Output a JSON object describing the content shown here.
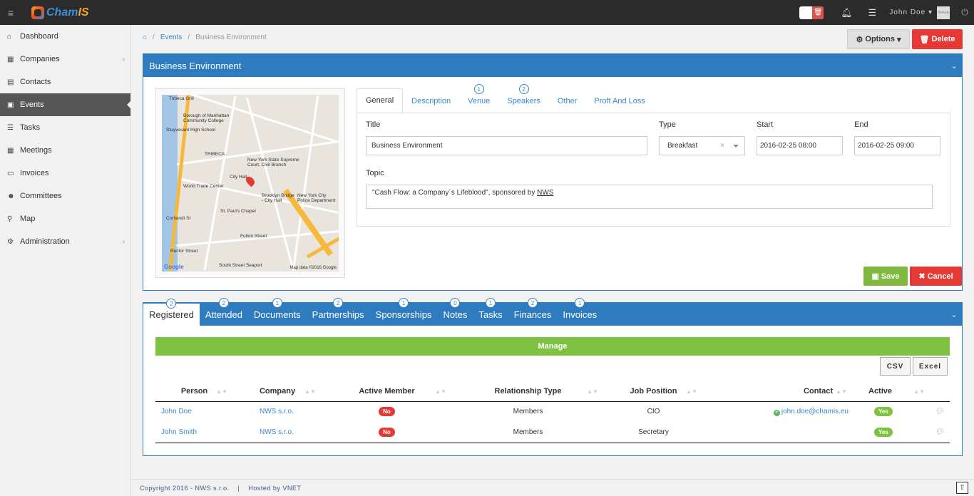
{
  "app": {
    "logo_text_a": "Cham",
    "logo_text_b": "IS"
  },
  "topbar": {
    "user_name": "John Doe",
    "avatar_text": "IMAGE"
  },
  "sidebar": {
    "items": [
      {
        "label": "Dashboard",
        "icon": "home-icon"
      },
      {
        "label": "Companies",
        "icon": "building-icon"
      },
      {
        "label": "Contacts",
        "icon": "book-icon"
      },
      {
        "label": "Events",
        "icon": "calendar-icon"
      },
      {
        "label": "Tasks",
        "icon": "tasks-icon"
      },
      {
        "label": "Meetings",
        "icon": "calendar-icon"
      },
      {
        "label": "Invoices",
        "icon": "invoice-icon"
      },
      {
        "label": "Committees",
        "icon": "users-icon"
      },
      {
        "label": "Map",
        "icon": "map-marker-icon"
      },
      {
        "label": "Administration",
        "icon": "gears-icon"
      }
    ]
  },
  "breadcrumb": {
    "events": "Events",
    "current": "Business Environment"
  },
  "header_buttons": {
    "options": "Options",
    "delete": "Delete"
  },
  "event_panel": {
    "title": "Business Environment",
    "map": {
      "copyright": "Map data ©2016 Google",
      "google": "Google"
    },
    "tabs": [
      {
        "label": "General",
        "badge": ""
      },
      {
        "label": "Description",
        "badge": ""
      },
      {
        "label": "Venue",
        "badge": "1"
      },
      {
        "label": "Speakers",
        "badge": "2"
      },
      {
        "label": "Other",
        "badge": ""
      },
      {
        "label": "Proft And Loss",
        "badge": ""
      }
    ],
    "form": {
      "title_label": "Title",
      "title_value": "Business Environment",
      "type_label": "Type",
      "type_value": "Breakfast",
      "start_label": "Start",
      "start_value": "2016-02-25 08:00",
      "end_label": "End",
      "end_value": "2016-02-25 09:00",
      "topic_label": "Topic",
      "topic_value": "\"Cash Flow: a Company´s Lifeblood\", sponsored by ",
      "topic_link": "NWS"
    },
    "save": "Save",
    "cancel": "Cancel"
  },
  "lower_panel": {
    "tabs": [
      {
        "label": "Registered",
        "badge": "2"
      },
      {
        "label": "Attended",
        "badge": "2"
      },
      {
        "label": "Documents",
        "badge": "1"
      },
      {
        "label": "Partnerships",
        "badge": "2"
      },
      {
        "label": "Sponsorships",
        "badge": "1"
      },
      {
        "label": "Notes",
        "badge": "0"
      },
      {
        "label": "Tasks",
        "badge": "1"
      },
      {
        "label": "Finances",
        "badge": "2"
      },
      {
        "label": "Invoices",
        "badge": "1"
      }
    ],
    "manage": "Manage",
    "csv": "CSV",
    "excel": "Excel",
    "columns": [
      "Person",
      "Company",
      "Active Member",
      "Relationship Type",
      "Job Position",
      "Contact",
      "Active"
    ],
    "rows": [
      {
        "person": "John Doe",
        "company": "NWS s.r.o.",
        "active_member": "No",
        "relationship": "Members",
        "job": "CIO",
        "contact": "john.doe@chamis.eu",
        "active": "Yes"
      },
      {
        "person": "John Smith",
        "company": "NWS s.r.o.",
        "active_member": "No",
        "relationship": "Members",
        "job": "Secretary",
        "contact": "",
        "active": "Yes"
      }
    ]
  },
  "footer": {
    "text": "Copyright 2016 - NWS s.r.o.    |    Hosted by VNET"
  }
}
